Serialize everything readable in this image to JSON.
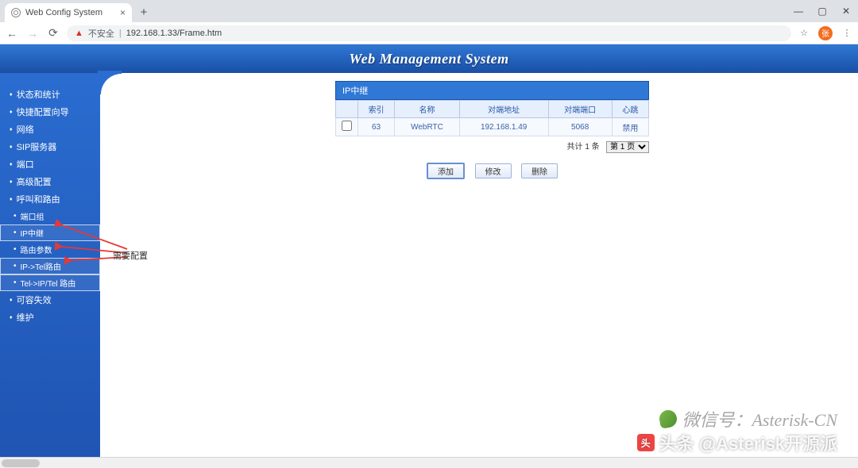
{
  "browser": {
    "tab_title": "Web Config System",
    "url": "192.168.1.33/Frame.htm",
    "insecure_label": "不安全"
  },
  "banner": {
    "title": "Web Management System"
  },
  "nav": {
    "items": [
      "状态和统计",
      "快捷配置向导",
      "网络",
      "SIP服务器",
      "端口",
      "高级配置",
      "呼叫和路由",
      "可容失效",
      "维护"
    ],
    "sub_call_route": [
      "端口组",
      "IP中继",
      "路由参数",
      "IP->Tel路由",
      "Tel->IP/Tel 路由"
    ]
  },
  "panel": {
    "title": "IP中继",
    "headers": {
      "c0": "",
      "c1": "索引",
      "c2": "名称",
      "c3": "对端地址",
      "c4": "对端端口",
      "c5": "心跳"
    },
    "rows": [
      {
        "index": "63",
        "name": "WebRTC",
        "peer_addr": "192.168.1.49",
        "peer_port": "5068",
        "heartbeat": "禁用"
      }
    ],
    "pager": {
      "total_label": "共计",
      "count": "1 条",
      "page_opt": "第 1 页"
    },
    "buttons": {
      "add": "添加",
      "mod": "修改",
      "del": "删除"
    }
  },
  "annotation": "需要配置",
  "watermark": {
    "line1": "微信号：Asterisk-CN",
    "line2": "头条 @Asterisk开源派"
  }
}
